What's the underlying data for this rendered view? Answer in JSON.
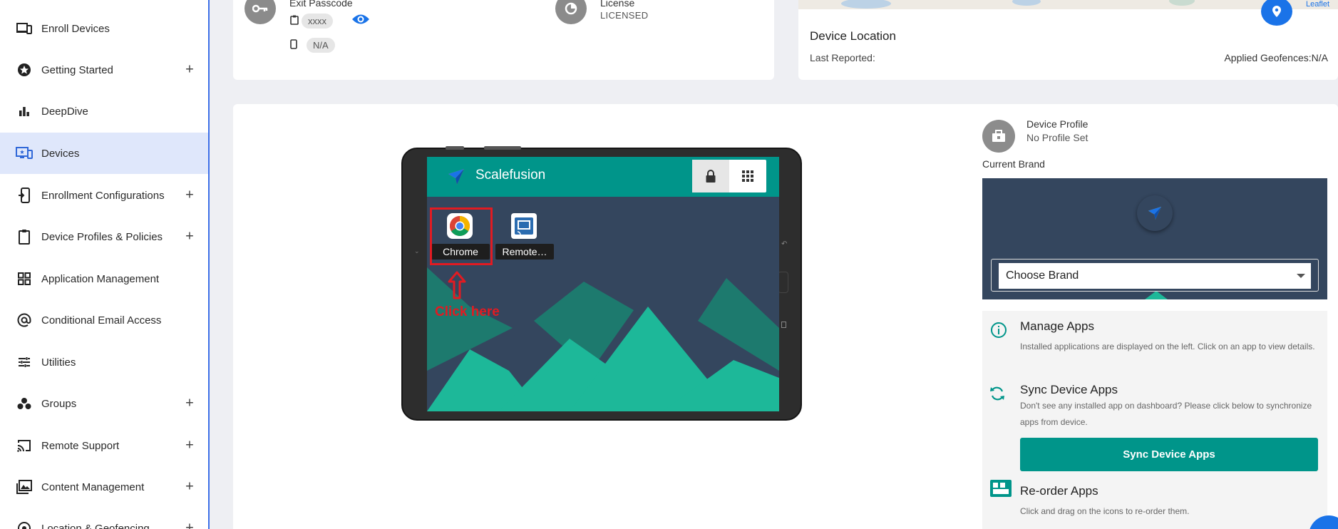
{
  "sidebar": {
    "items": [
      {
        "label": "Enroll Devices",
        "icon": "enroll-devices-icon",
        "expandable": false
      },
      {
        "label": "Getting Started",
        "icon": "star-badge-icon",
        "expandable": true
      },
      {
        "label": "DeepDive",
        "icon": "bar-chart-icon",
        "expandable": false
      },
      {
        "label": "Devices",
        "icon": "devices-icon",
        "expandable": false,
        "active": true
      },
      {
        "label": "Enrollment Configurations",
        "icon": "enrollment-config-icon",
        "expandable": true
      },
      {
        "label": "Device Profiles & Policies",
        "icon": "clipboard-icon",
        "expandable": true
      },
      {
        "label": "Application Management",
        "icon": "apps-grid-icon",
        "expandable": false
      },
      {
        "label": "Conditional Email Access",
        "icon": "at-sign-icon",
        "expandable": false
      },
      {
        "label": "Utilities",
        "icon": "sliders-icon",
        "expandable": false
      },
      {
        "label": "Groups",
        "icon": "groups-icon",
        "expandable": true
      },
      {
        "label": "Remote Support",
        "icon": "cast-icon",
        "expandable": true
      },
      {
        "label": "Content Management",
        "icon": "image-gallery-icon",
        "expandable": true
      },
      {
        "label": "Location & Geofencing",
        "icon": "location-icon",
        "expandable": true
      }
    ],
    "plus_glyph": "+",
    "active_color": "#dfe7fb"
  },
  "passcode_card": {
    "exit_passcode_label": "Exit Passcode",
    "passcode_value": "xxxx",
    "phone_value": "N/A",
    "license_label": "License",
    "license_value": "LICENSED"
  },
  "location_card": {
    "title": "Device Location",
    "last_reported_label": "Last Reported:",
    "last_reported_value": "",
    "geofences_label": "Applied Geofences:",
    "geofences_value": "N/A",
    "map_attribution": "Leaflet"
  },
  "tablet": {
    "app_title": "Scalefusion",
    "apps": [
      {
        "label": "Chrome",
        "icon": "chrome-icon"
      },
      {
        "label": "Remote…",
        "icon": "remote-cast-icon"
      }
    ],
    "annotation": "Click here",
    "annotation_color": "#e11b22"
  },
  "right_panel": {
    "device_profile_label": "Device Profile",
    "device_profile_value": "No Profile Set",
    "current_brand_label": "Current Brand",
    "brand_select_value": "Choose Brand",
    "manage_apps_title": "Manage Apps",
    "manage_apps_desc": "Installed applications are displayed on the left. Click on an app to view details.",
    "sync_title": "Sync Device Apps",
    "sync_desc": "Don't see any installed app on dashboard? Please click below to synchronize apps from device.",
    "sync_button": "Sync Device Apps",
    "reorder_title": "Re-order Apps",
    "reorder_desc": "Click and drag on the icons to re-order them.",
    "accent": "#00958a"
  }
}
